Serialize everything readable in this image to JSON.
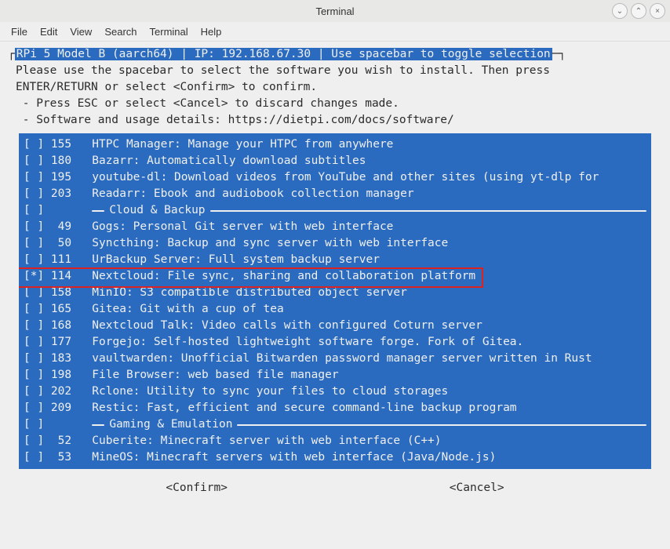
{
  "window": {
    "title": "Terminal"
  },
  "menubar": {
    "items": [
      "File",
      "Edit",
      "View",
      "Search",
      "Terminal",
      "Help"
    ]
  },
  "header": "RPi 5 Model B (aarch64) | IP: 192.168.67.30 | Use spacebar to toggle selection",
  "intro": {
    "line1": "Please use the spacebar to select the software you wish to install. Then press",
    "line2": "ENTER/RETURN or select <Confirm> to confirm.",
    "line3": " - Press ESC or select <Cancel> to discard changes made.",
    "line4": " - Software and usage details: https://dietpi.com/docs/software/"
  },
  "list": [
    {
      "sel": " ",
      "id": "155",
      "text": "HTPC Manager: Manage your HTPC from anywhere"
    },
    {
      "sel": " ",
      "id": "180",
      "text": "Bazarr: Automatically download subtitles"
    },
    {
      "sel": " ",
      "id": "195",
      "text": "youtube-dl: Download videos from YouTube and other sites (using yt-dlp for"
    },
    {
      "sel": " ",
      "id": "203",
      "text": "Readarr: Ebook and audiobook collection manager"
    },
    {
      "section": "Cloud & Backup"
    },
    {
      "sel": " ",
      "id": "49",
      "text": "Gogs: Personal Git server with web interface"
    },
    {
      "sel": " ",
      "id": "50",
      "text": "Syncthing: Backup and sync server with web interface"
    },
    {
      "sel": " ",
      "id": "111",
      "text": "UrBackup Server: Full system backup server"
    },
    {
      "sel": "*",
      "id": "114",
      "text": "Nextcloud: File sync, sharing and collaboration platform",
      "highlight": true
    },
    {
      "sel": " ",
      "id": "158",
      "text": "MinIO: S3 compatible distributed object server"
    },
    {
      "sel": " ",
      "id": "165",
      "text": "Gitea: Git with a cup of tea"
    },
    {
      "sel": " ",
      "id": "168",
      "text": "Nextcloud Talk: Video calls with configured Coturn server"
    },
    {
      "sel": " ",
      "id": "177",
      "text": "Forgejo: Self-hosted lightweight software forge. Fork of Gitea."
    },
    {
      "sel": " ",
      "id": "183",
      "text": "vaultwarden: Unofficial Bitwarden password manager server written in Rust"
    },
    {
      "sel": " ",
      "id": "198",
      "text": "File Browser: web based file manager"
    },
    {
      "sel": " ",
      "id": "202",
      "text": "Rclone: Utility to sync your files to cloud storages"
    },
    {
      "sel": " ",
      "id": "209",
      "text": "Restic: Fast, efficient and secure command-line backup program"
    },
    {
      "section": "Gaming & Emulation"
    },
    {
      "sel": " ",
      "id": "52",
      "text": "Cuberite: Minecraft server with web interface (C++)"
    },
    {
      "sel": " ",
      "id": "53",
      "text": "MineOS: Minecraft servers with web interface (Java/Node.js)"
    }
  ],
  "buttons": {
    "confirm": "<Confirm>",
    "cancel": "<Cancel>"
  }
}
